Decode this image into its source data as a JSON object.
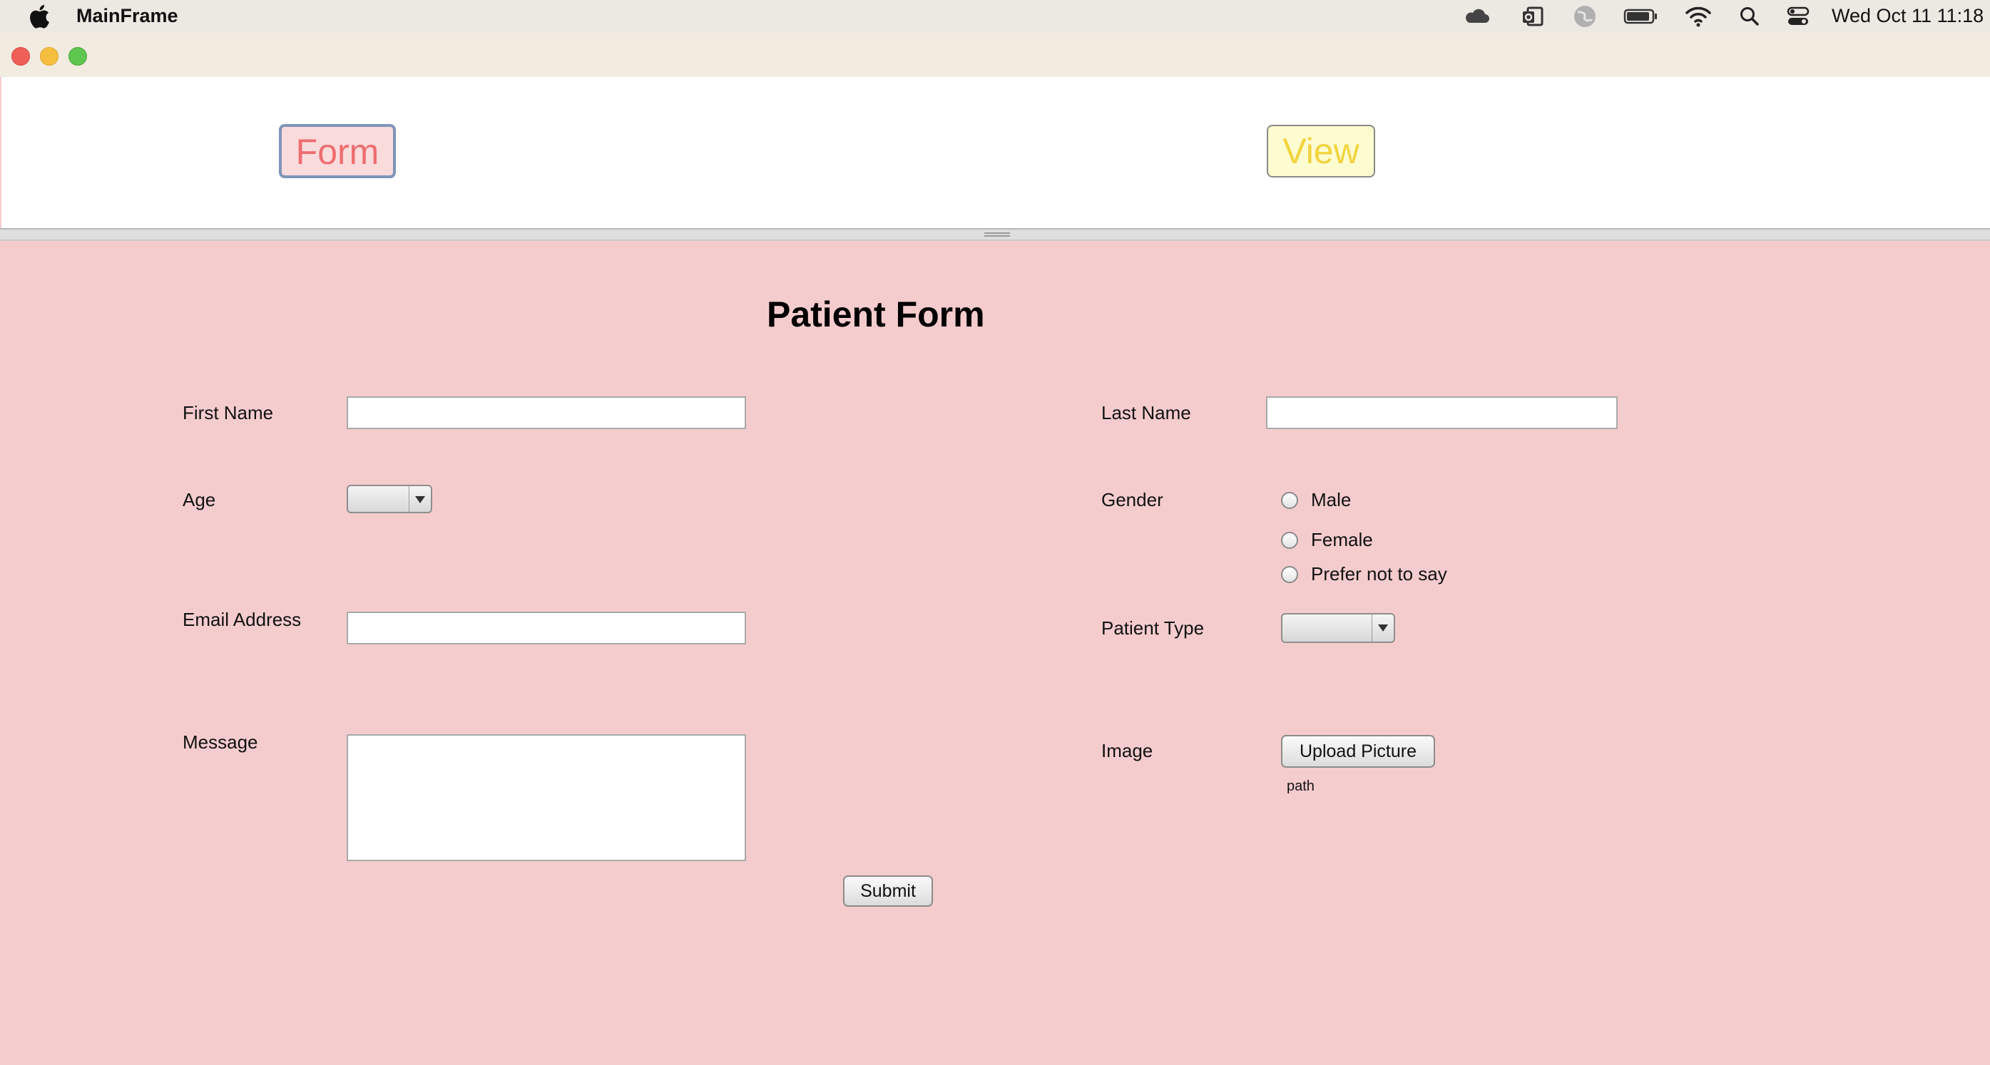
{
  "menubar": {
    "app_title": "MainFrame",
    "datetime": "Wed Oct 11  11:18",
    "icons": [
      "apple-icon",
      "cloud-icon",
      "outlook-icon",
      "globe-icon",
      "battery-icon",
      "wifi-icon",
      "search-icon",
      "control-center-icon"
    ]
  },
  "nav": {
    "form_label": "Form",
    "view_label": "View"
  },
  "form": {
    "title": "Patient Form",
    "first_name_label": "First Name",
    "first_name_value": "",
    "last_name_label": "Last Name",
    "last_name_value": "",
    "age_label": "Age",
    "age_value": "",
    "gender_label": "Gender",
    "gender_options": [
      "Male",
      "Female",
      "Prefer not to say"
    ],
    "email_label": "Email Address",
    "email_value": "",
    "patient_type_label": "Patient Type",
    "patient_type_value": "",
    "message_label": "Message",
    "message_value": "",
    "image_label": "Image",
    "upload_button": "Upload Picture",
    "path_text": "path",
    "submit_button": "Submit"
  },
  "colors": {
    "form_bg": "#f5cccd",
    "form_button_text": "#ee6d6f",
    "view_button_text": "#f1d43e"
  }
}
